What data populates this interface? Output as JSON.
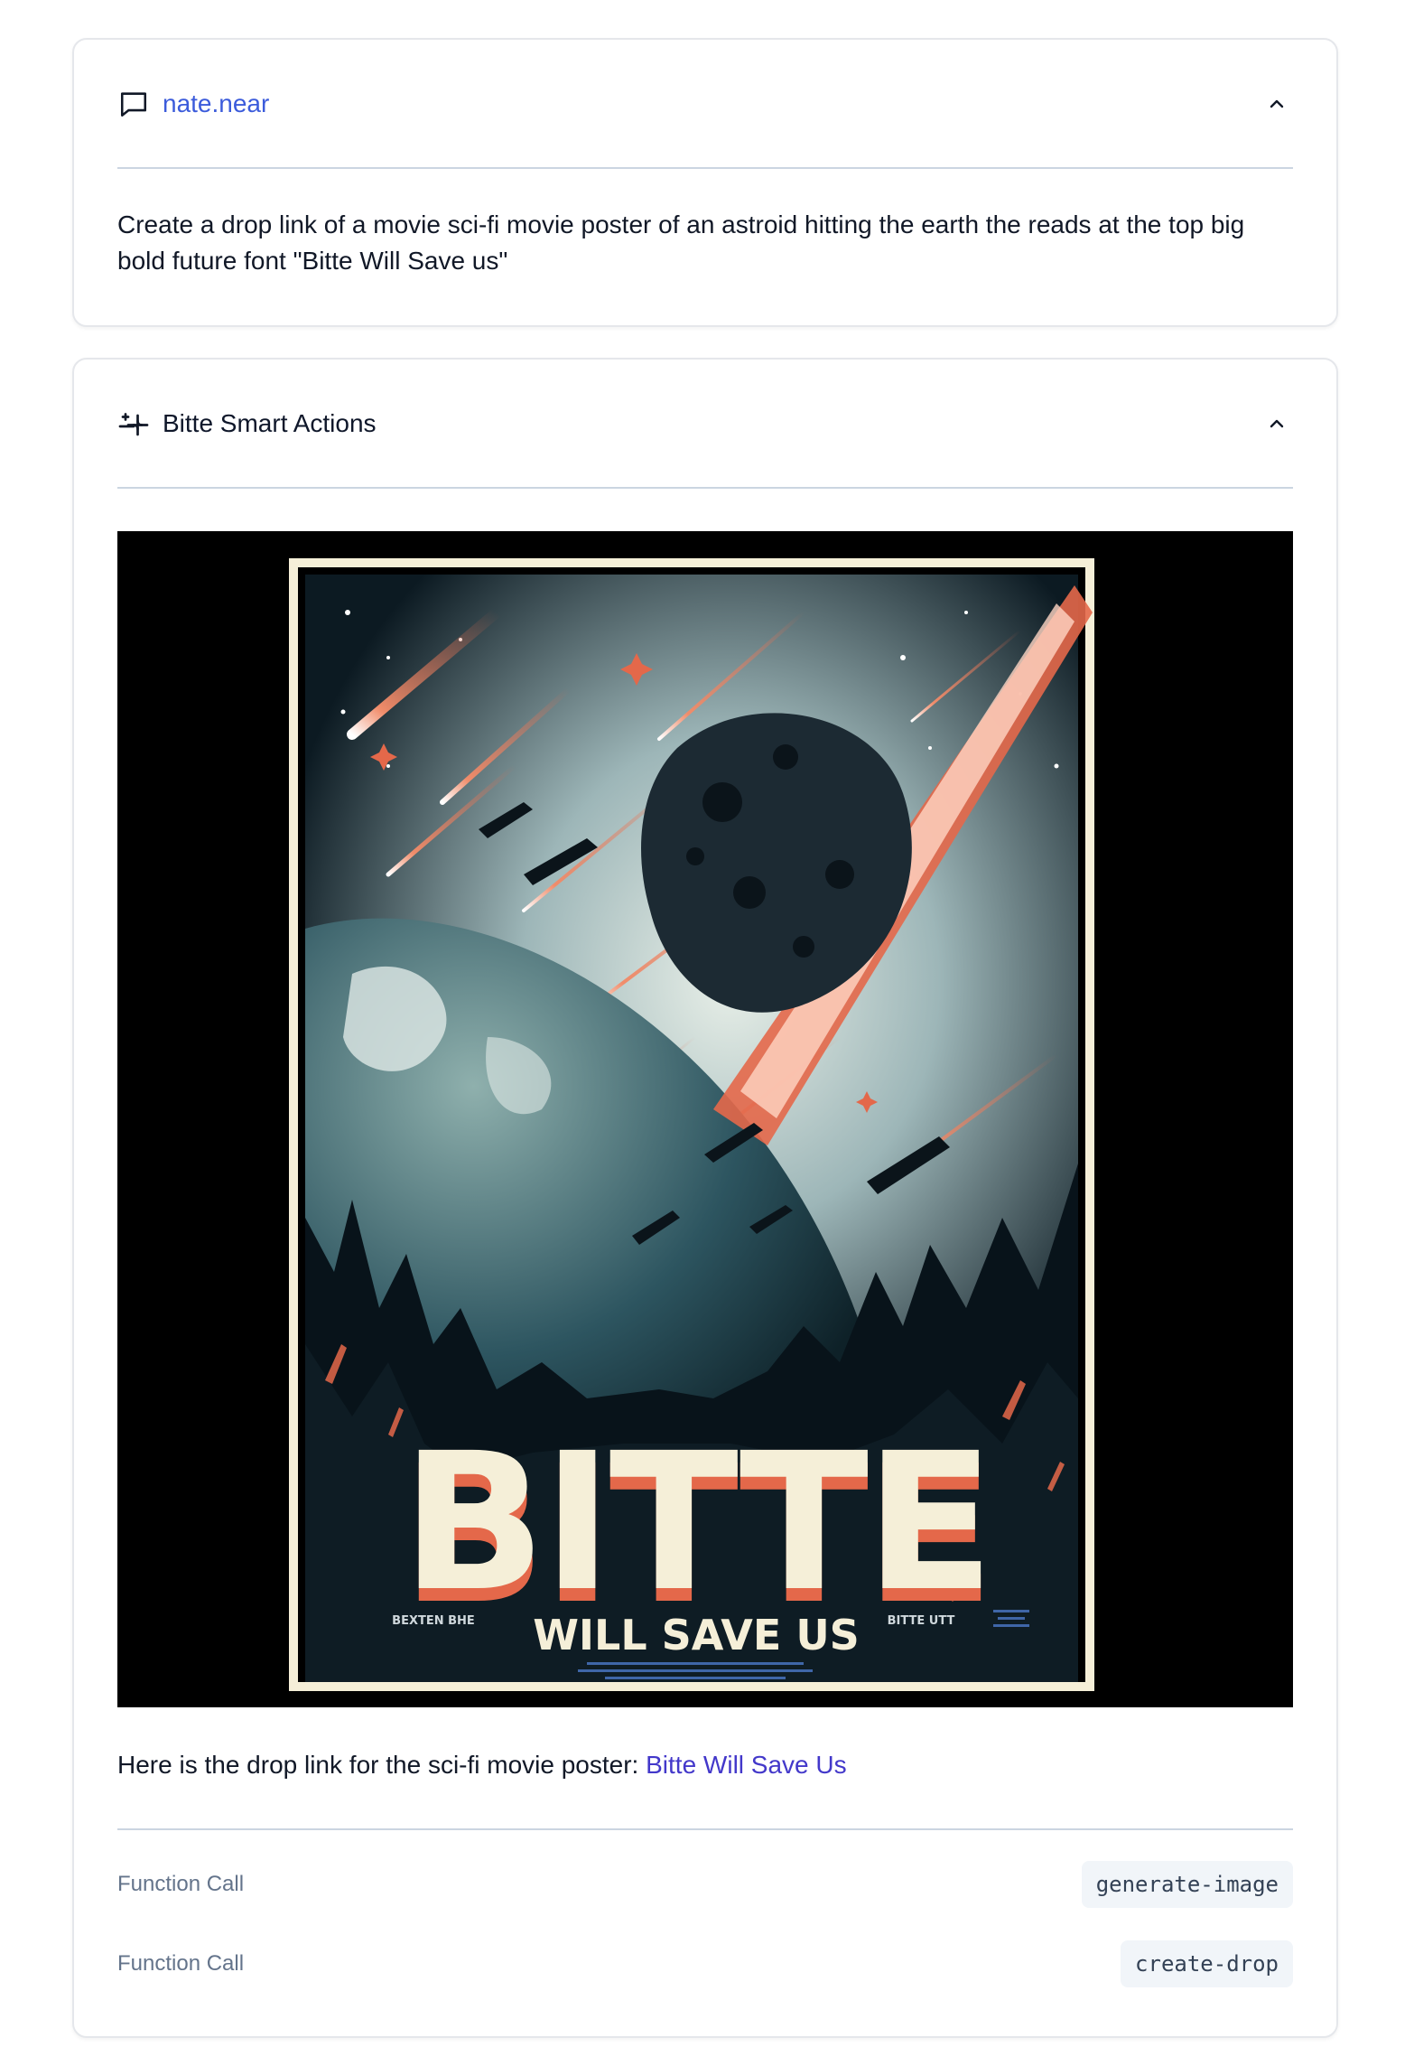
{
  "user_message": {
    "username": "nate.near",
    "text": "Create a drop link of a movie sci-fi movie poster of an astroid hitting the earth the reads at the top big bold future font \"Bitte Will Save us\"",
    "icon": "chat-bubble-icon"
  },
  "agent_message": {
    "title": "Bitte Smart Actions",
    "icon": "sparkle-icon",
    "poster": {
      "headline": "BITTE",
      "subhead": "WILL SAVE US",
      "left_credit": "BEXTEN BHE",
      "right_credit": "BITTE UTT"
    },
    "drop_text": "Here is the drop link for the sci-fi movie poster: ",
    "drop_link": "Bitte Will Save Us",
    "function_calls": [
      {
        "label": "Function Call",
        "name": "generate-image"
      },
      {
        "label": "Function Call",
        "name": "create-drop"
      }
    ]
  },
  "colors": {
    "link": "#3b5bdb",
    "accent_link": "#4338ca",
    "poster_cream": "#f5efd8",
    "poster_orange": "#e4684a"
  }
}
